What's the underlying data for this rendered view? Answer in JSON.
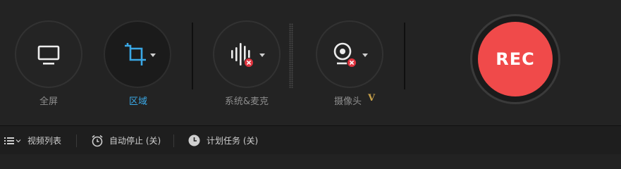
{
  "modes": [
    {
      "id": "fullscreen",
      "label": "全屏",
      "icon": "monitor-icon",
      "active": false
    },
    {
      "id": "region",
      "label": "区域",
      "icon": "crop-icon",
      "active": true
    },
    {
      "id": "audio",
      "label": "系统&麦克",
      "icon": "audio-waveform-icon",
      "active": false
    },
    {
      "id": "webcam",
      "label": "摄像头",
      "icon": "webcam-icon",
      "active": false
    }
  ],
  "vip_badge": "V",
  "rec_label": "REC",
  "bottom_bar": {
    "video_list": "视频列表",
    "auto_stop": "自动停止 (关)",
    "scheduled_task": "计划任务 (关)"
  },
  "colors": {
    "accent": "#3aa8e6",
    "rec": "#f04a4a",
    "disabled_badge": "#e0343f",
    "vip": "#c9a24a"
  }
}
